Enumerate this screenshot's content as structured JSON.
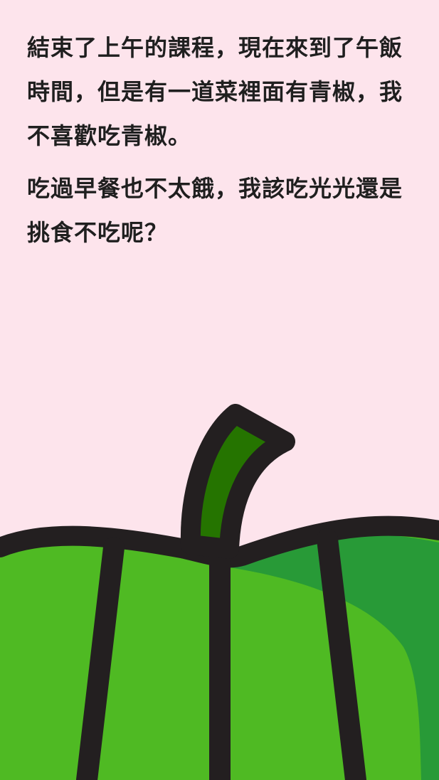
{
  "story": {
    "paragraph_1": "結束了上午的課程，現在來到了午飯時間，但是有一道菜裡面有青椒，我不喜歡吃青椒。",
    "paragraph_2": "吃過早餐也不太餓，我該吃光光還是挑食不吃呢？"
  },
  "illustration": {
    "icon": "green-pepper-icon",
    "colors": {
      "background": "#fde4ec",
      "pepper_green": "#4fba23",
      "pepper_shade": "#289a37",
      "stem_green": "#257400",
      "outline": "#231f20"
    }
  }
}
